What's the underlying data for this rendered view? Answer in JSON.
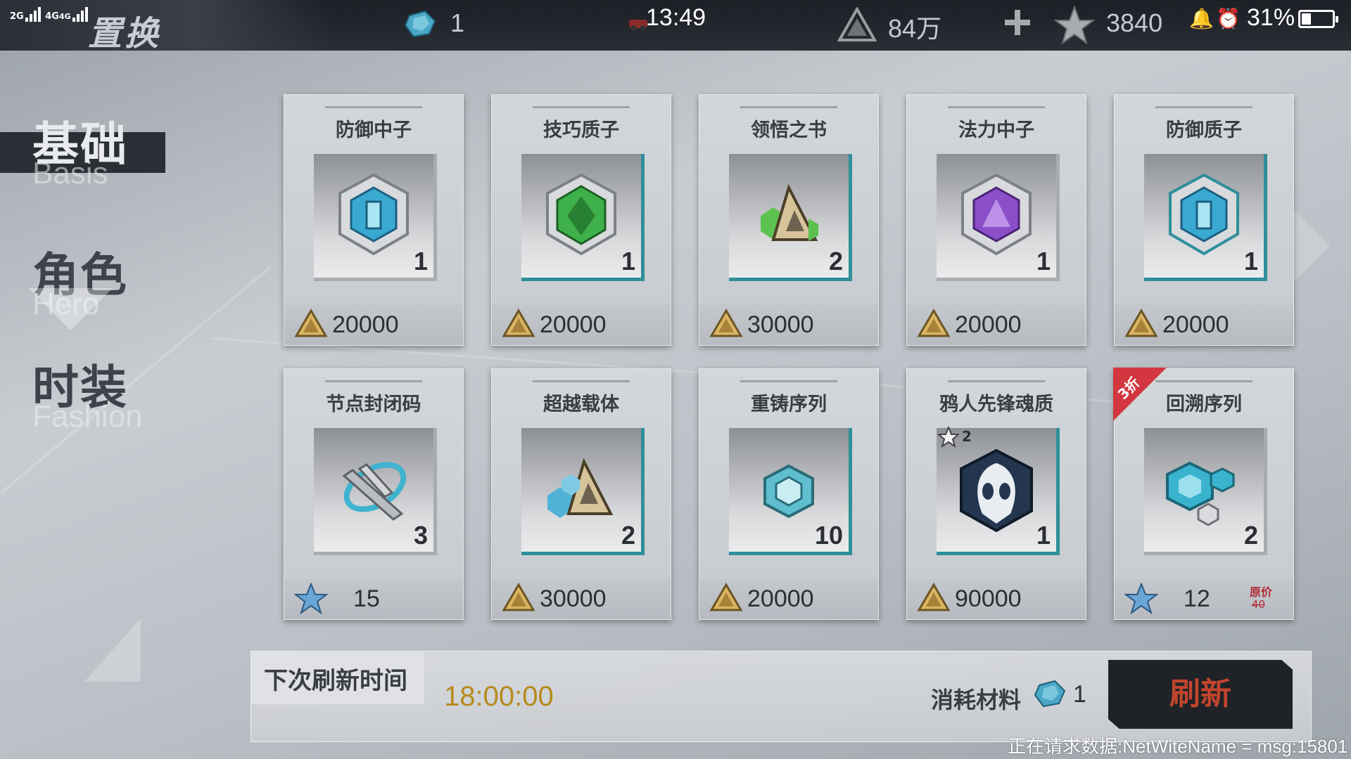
{
  "status_bar": {
    "network1": "2G",
    "network2": "4G",
    "network3": "4G",
    "time": "13:49",
    "battery_pct": "31%",
    "battery_level": 0.31
  },
  "header": {
    "title": "置换",
    "material_count": "1",
    "gold": "84万",
    "stars": "3840"
  },
  "sidebar": {
    "items": [
      {
        "label": "基础",
        "sub": "Basis",
        "active": true
      },
      {
        "label": "角色",
        "sub": "Hero",
        "active": false
      },
      {
        "label": "时装",
        "sub": "Fashion",
        "active": false
      }
    ]
  },
  "items": [
    {
      "name": "防御中子",
      "qty": "1",
      "price": "20000",
      "currency": "gold",
      "icon": "defense-neutron-icon"
    },
    {
      "name": "技巧质子",
      "qty": "1",
      "price": "20000",
      "currency": "gold",
      "icon": "skill-proton-icon"
    },
    {
      "name": "领悟之书",
      "qty": "2",
      "price": "30000",
      "currency": "gold",
      "icon": "insight-book-icon"
    },
    {
      "name": "法力中子",
      "qty": "1",
      "price": "20000",
      "currency": "gold",
      "icon": "mana-neutron-icon"
    },
    {
      "name": "防御质子",
      "qty": "1",
      "price": "20000",
      "currency": "gold",
      "icon": "defense-proton-icon"
    },
    {
      "name": "节点封闭码",
      "qty": "3",
      "price": "15",
      "currency": "star",
      "icon": "node-seal-code-icon"
    },
    {
      "name": "超越载体",
      "qty": "2",
      "price": "30000",
      "currency": "gold",
      "icon": "transcend-carrier-icon"
    },
    {
      "name": "重铸序列",
      "qty": "10",
      "price": "20000",
      "currency": "gold",
      "icon": "reforge-sequence-icon"
    },
    {
      "name": "鸦人先锋魂质",
      "qty": "1",
      "price": "90000",
      "currency": "gold",
      "icon": "crow-vanguard-soul-icon",
      "star_level": "2"
    },
    {
      "name": "回溯序列",
      "qty": "2",
      "price": "12",
      "currency": "star",
      "icon": "retrace-sequence-icon",
      "badge": "3折",
      "orig_label": "原价",
      "orig_price": "40"
    }
  ],
  "bottom": {
    "refresh_label": "下次刷新时间",
    "refresh_time": "18:00:00",
    "cost_label": "消耗材料",
    "cost_qty": "1",
    "refresh_button": "刷新"
  },
  "status_message": "正在请求数据:NetWiteName = msg:15801",
  "colors": {
    "accent_teal": "#2f8f9a",
    "refresh_text": "#c0452d",
    "time_gold": "#b78a1e",
    "sale_red": "#d2373f"
  }
}
